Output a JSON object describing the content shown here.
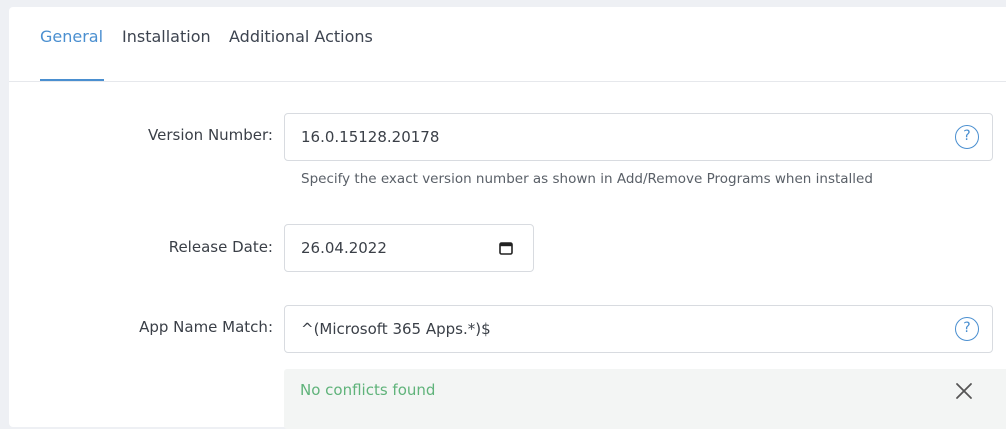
{
  "tabs": [
    {
      "label": "General",
      "active": true
    },
    {
      "label": "Installation",
      "active": false
    },
    {
      "label": "Additional Actions",
      "active": false
    }
  ],
  "version": {
    "label": "Version Number:",
    "value": "16.0.15128.20178",
    "help_icon": "question-circle-icon",
    "hint": "Specify the exact version number as shown in Add/Remove Programs when installed"
  },
  "release": {
    "label": "Release Date:",
    "value": "26.04.2022",
    "icon": "calendar-icon"
  },
  "appname": {
    "label": "App Name Match:",
    "value": "^(Microsoft 365 Apps.*)$",
    "help_icon": "question-circle-icon"
  },
  "conflicts": {
    "message": "No conflicts found",
    "close_icon": "close-icon"
  },
  "colors": {
    "accent": "#4a8fd0",
    "success_text": "#5fb37a",
    "alert_bg": "#f3f5f4"
  }
}
